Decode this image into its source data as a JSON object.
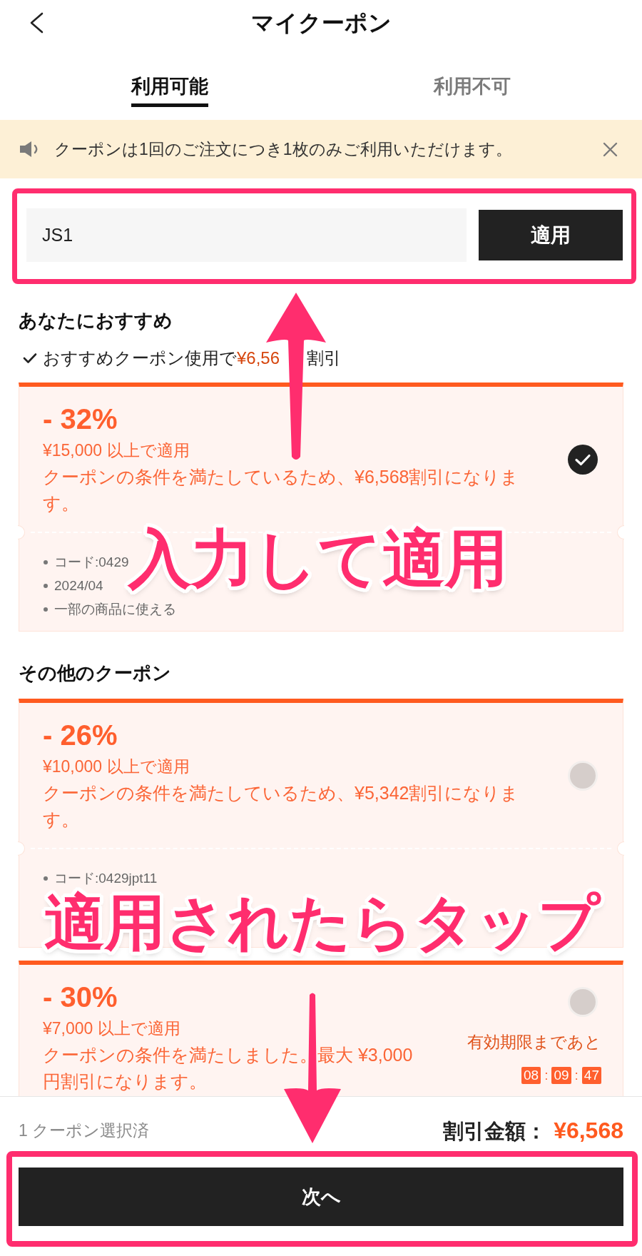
{
  "header": {
    "title": "マイクーポン"
  },
  "tabs": [
    {
      "label": "利用可能",
      "selected": true
    },
    {
      "label": "利用不可",
      "selected": false
    }
  ],
  "notice": {
    "text": "クーポンは1回のご注文につき1枚のみご利用いただけます。"
  },
  "code_entry": {
    "value": "JS1",
    "button": "適用",
    "highlighted": true
  },
  "sections": [
    {
      "title": "あなたにおすすめ",
      "note": {
        "text": "おすすめクーポン使用で",
        "amount": "¥6,56",
        "suffix": "割引"
      },
      "coupons": [
        {
          "discount": "- 32%",
          "condition": "¥15,000 以上で適用",
          "description": "クーポンの条件を満たしているため、¥6,568割引になります。",
          "selected": true,
          "details": [
            "コード:0429",
            "2024/04",
            "一部の商品に使える"
          ]
        }
      ]
    },
    {
      "title": "その他のクーポン",
      "coupons": [
        {
          "discount": "- 26%",
          "condition": "¥10,000 以上で適用",
          "description": "クーポンの条件を満たしているため、¥5,342割引になります。",
          "selected": false,
          "details": [
            "コード:0429jpt11"
          ]
        },
        {
          "discount": "- 30%",
          "condition": "¥7,000 以上で適用",
          "description": "クーポンの条件を満たしました。最大 ¥3,000円割引になります。",
          "selected": false,
          "countdown": {
            "label": "有効期限まであと",
            "units": [
              "08",
              "09",
              "47"
            ],
            "separator": ":"
          }
        }
      ]
    }
  ],
  "footer": {
    "selected_count": "1 クーポン選択済",
    "total_label": "割引金額：",
    "total_value": "¥6,568",
    "next_button": "次へ",
    "highlighted": true
  },
  "annotations": [
    {
      "kind": "arrow_up"
    },
    {
      "kind": "caption",
      "text": "入力して適用"
    },
    {
      "kind": "caption",
      "text": "適用されたらタップ"
    },
    {
      "kind": "arrow_down"
    }
  ]
}
